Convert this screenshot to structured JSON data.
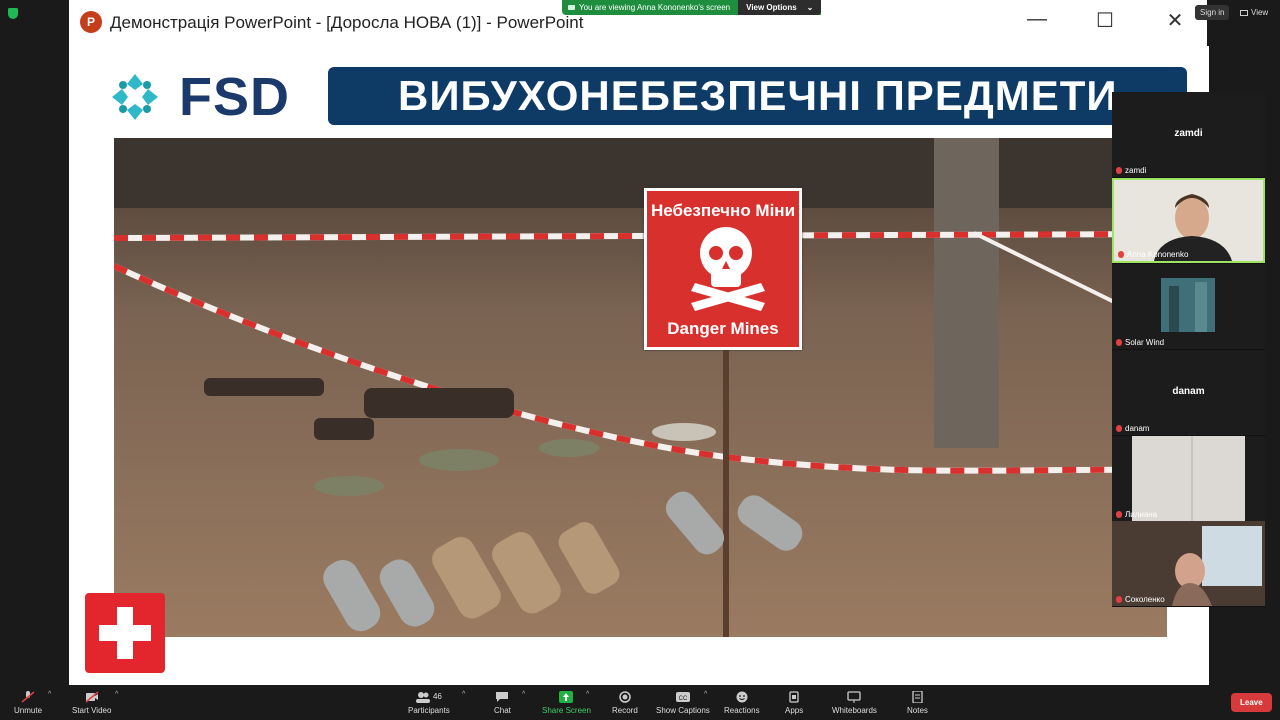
{
  "zoom": {
    "viewing_banner": "You are viewing Anna Kononenko's screen",
    "view_options": "View Options",
    "sign_in": "Sign in",
    "view": "View"
  },
  "window": {
    "title": "Демонстрація PowerPoint - [Доросла НОВА (1)] - PowerPoint",
    "minimize": "—",
    "maximize": "☐",
    "close": "✕"
  },
  "slide": {
    "logo_text": "FSD",
    "heading": "ВИБУХОНЕБЕЗПЕЧНІ ПРЕДМЕТИ",
    "sign_top": "Небезпечно Міни",
    "sign_bottom": "Danger Mines"
  },
  "participants": [
    {
      "name": "zamdi",
      "big": "zamdi",
      "muted": true
    },
    {
      "name": "Anna Kononenko",
      "big": "",
      "muted": true,
      "active": true
    },
    {
      "name": "Solar Wind",
      "big": "",
      "muted": true
    },
    {
      "name": "danam",
      "big": "danam",
      "muted": true
    },
    {
      "name": "Лилиана",
      "big": "",
      "muted": true
    },
    {
      "name": "Соколенко",
      "big": "",
      "muted": true
    }
  ],
  "toolbar": {
    "unmute": "Unmute",
    "start_video": "Start Video",
    "participants": "Participants",
    "participants_count": "46",
    "chat": "Chat",
    "share_screen": "Share Screen",
    "record": "Record",
    "show_captions": "Show Captions",
    "reactions": "Reactions",
    "apps": "Apps",
    "whiteboards": "Whiteboards",
    "notes": "Notes",
    "leave": "Leave"
  },
  "colors": {
    "banner": "#0e3a66",
    "sign": "#d8302d",
    "share_green": "#1fb141",
    "leave_red": "#d63a3a"
  }
}
